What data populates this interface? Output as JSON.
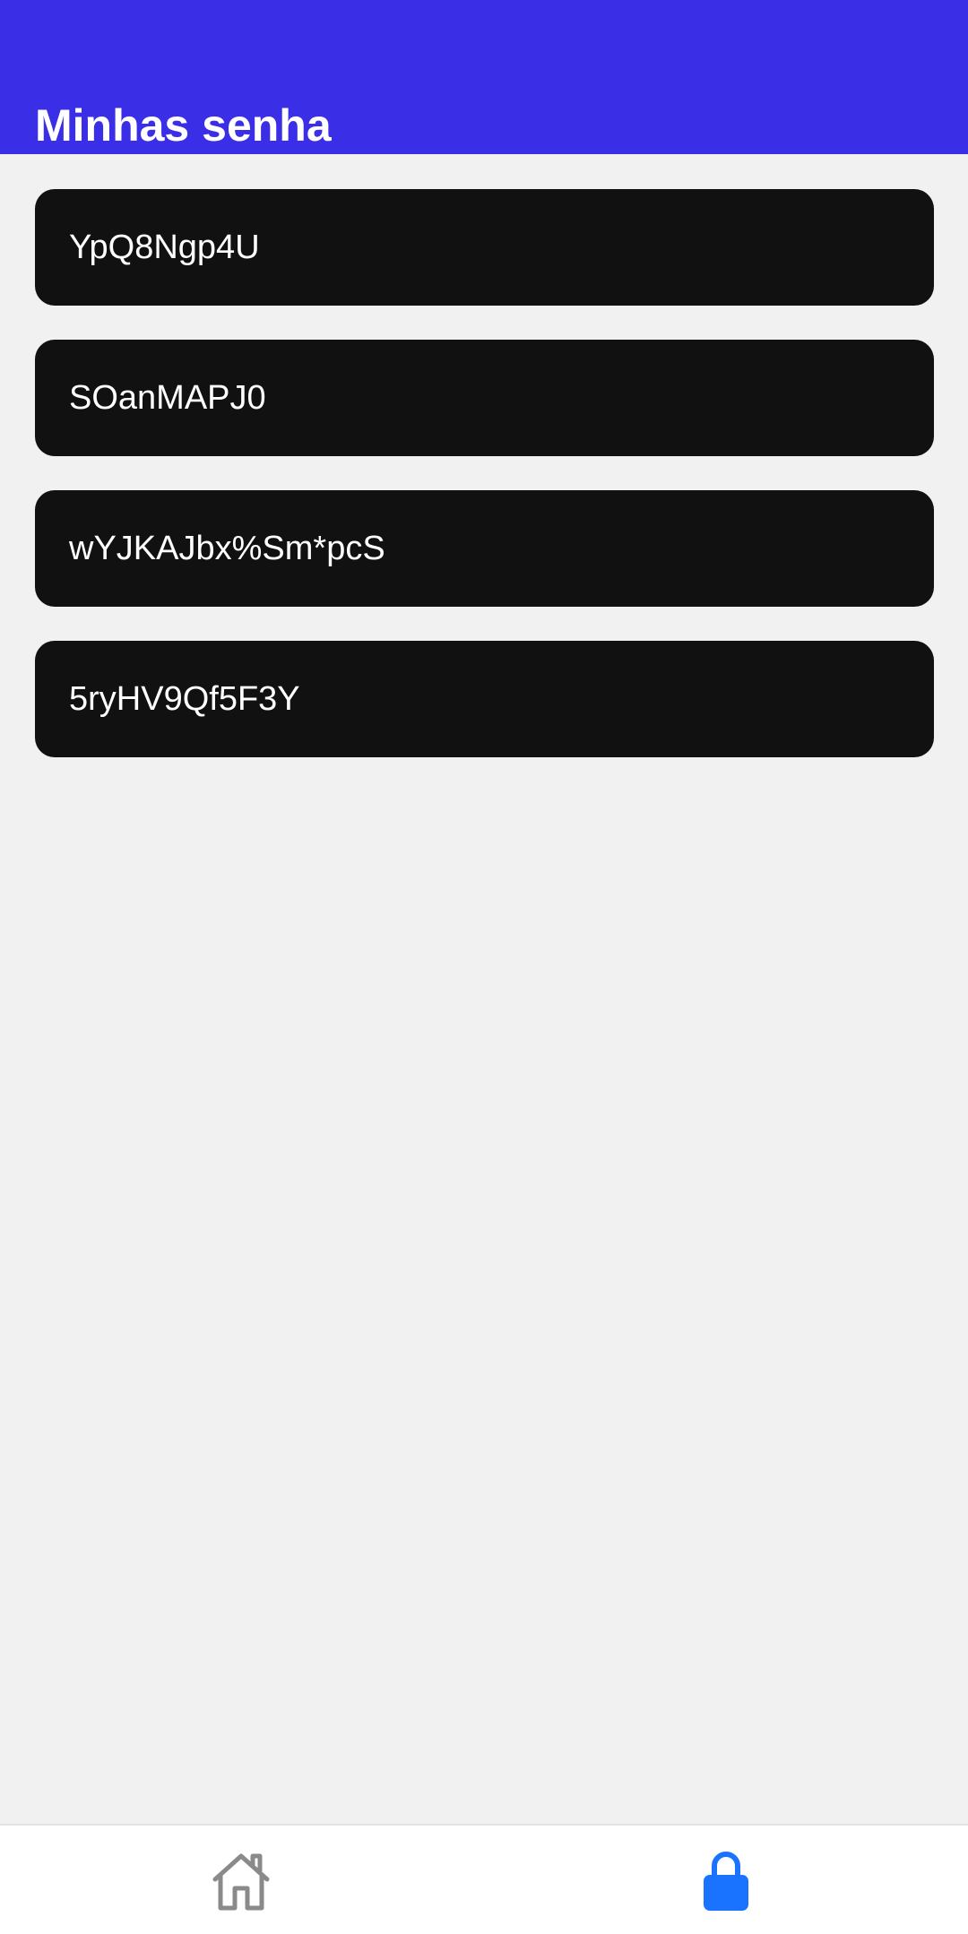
{
  "header": {
    "title": "Minhas senha",
    "background_color": "#3a2ee6"
  },
  "passwords": [
    {
      "value": "YpQ8Ngp4U"
    },
    {
      "value": "SOanMAPJ0"
    },
    {
      "value": "wYJKAJbx%Sm*pcS"
    },
    {
      "value": "5ryHV9Qf5F3Y"
    }
  ],
  "bottom_nav": {
    "items": [
      {
        "icon": "home-icon",
        "active": false,
        "color": "#8a8a8a"
      },
      {
        "icon": "lock-icon",
        "active": true,
        "color": "#1a73ff"
      }
    ]
  }
}
